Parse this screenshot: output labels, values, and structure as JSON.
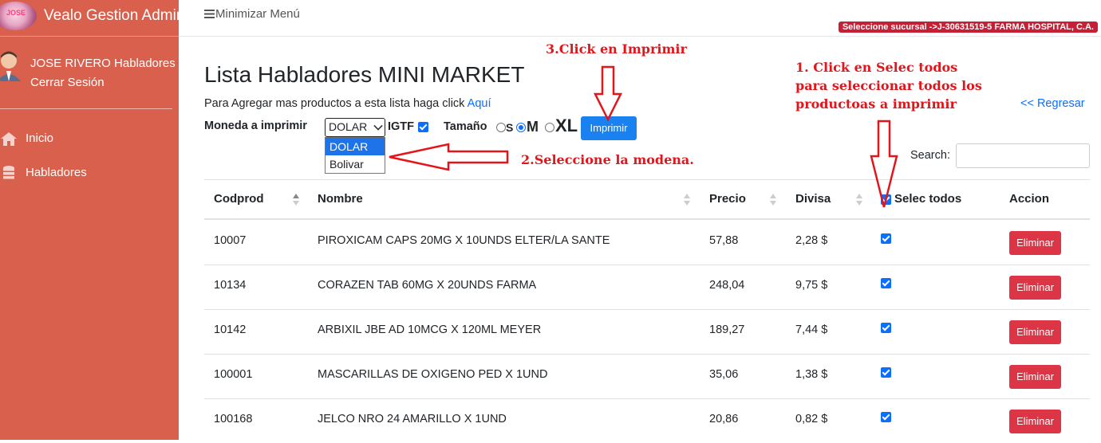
{
  "brand": {
    "title": "Vealo Gestion Admin",
    "logo_text": "JOSE"
  },
  "user": {
    "name": "JOSE RIVERO Habladores",
    "logout": "Cerrar Sesión"
  },
  "nav": [
    {
      "label": "Inicio",
      "icon": "home-icon"
    },
    {
      "label": "Habladores",
      "icon": "database-icon"
    }
  ],
  "topbar": {
    "toggle_label": "Minimizar Menú",
    "branch_badge": "Seleccione sucursal ->J-30631519-5 FARMA HOSPITAL, C.A."
  },
  "page": {
    "title": "Lista Habladores MINI MARKET",
    "add_text": "Para Agregar mas productos a esta lista haga click",
    "add_link": "Aquí",
    "back_link": "<< Regresar"
  },
  "options": {
    "currency_label": "Moneda a imprimir",
    "currency_selected": "DOLAR",
    "currency_options": [
      "DOLAR",
      "Bolivar"
    ],
    "igtf_label": "IGTF",
    "igtf_checked": true,
    "size_label": "Tamaño",
    "sizes": [
      "S",
      "M",
      "XL"
    ],
    "size_selected": "M",
    "print_button": "Imprimir"
  },
  "search": {
    "label": "Search:",
    "value": ""
  },
  "table": {
    "columns": [
      "Codprod",
      "Nombre",
      "Precio",
      "Divisa",
      "Selec todos",
      "Accion"
    ],
    "select_all_checked": true,
    "delete_label": "Eliminar",
    "rows": [
      {
        "code": "10007",
        "name": "PIROXICAM CAPS 20MG X 10UNDS ELTER/LA SANTE",
        "price": "57,88",
        "divisa": "2,28 $",
        "checked": true
      },
      {
        "code": "10134",
        "name": "CORAZEN TAB 60MG X 20UNDS FARMA",
        "price": "248,04",
        "divisa": "9,75 $",
        "checked": true
      },
      {
        "code": "10142",
        "name": "ARBIXIL JBE AD 10MCG X 120ML MEYER",
        "price": "189,27",
        "divisa": "7,44 $",
        "checked": true
      },
      {
        "code": "100001",
        "name": "MASCARILLAS DE OXIGENO PED X 1UND",
        "price": "35,06",
        "divisa": "1,38 $",
        "checked": true
      },
      {
        "code": "100168",
        "name": "JELCO NRO 24 AMARILLO X 1UND",
        "price": "20,86",
        "divisa": "0,82 $",
        "checked": true
      }
    ]
  },
  "annotations": {
    "step1_line1": "1. Click en Selec todos",
    "step1_line2": "para seleccionar todos los",
    "step1_line3": "productoas a imprimir",
    "step2": "2.Seleccione la modena.",
    "step3": "3.Click en Imprimir",
    "color": "#e3151b"
  },
  "colors": {
    "sidebar": "#d9604c",
    "primary": "#0d6efd",
    "danger": "#dc3545",
    "badge": "#c52035"
  }
}
